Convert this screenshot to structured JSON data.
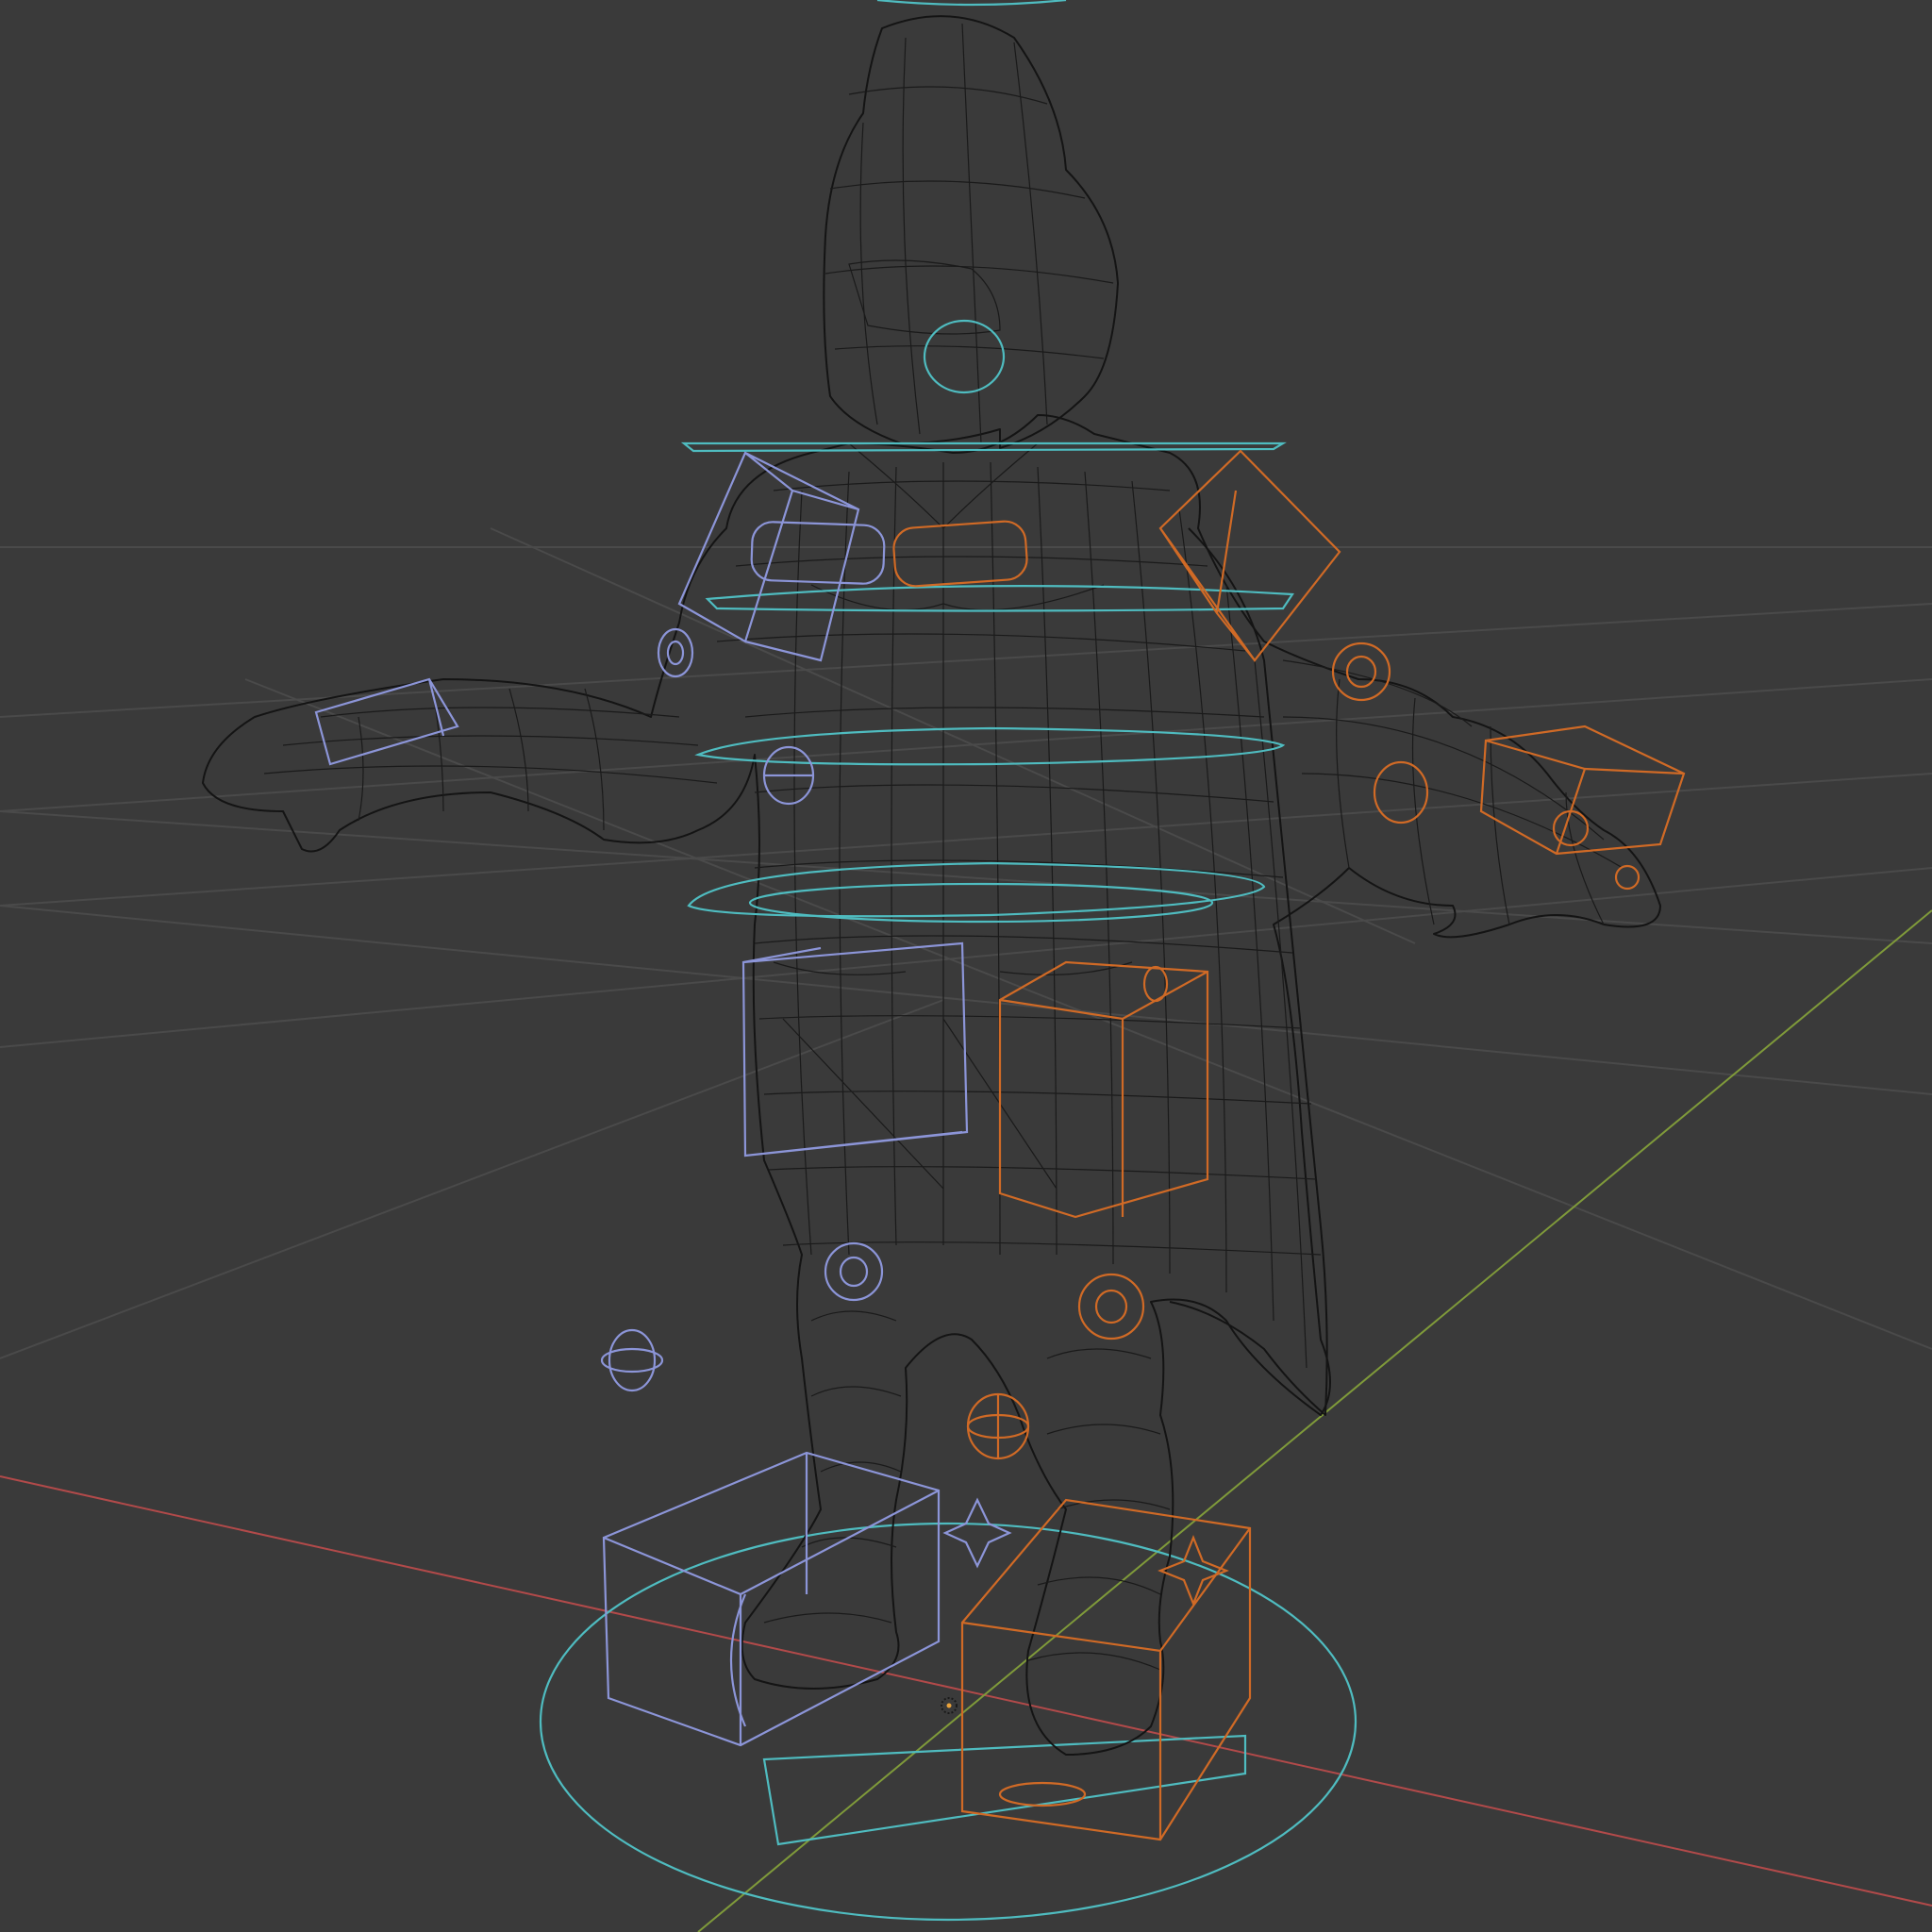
{
  "viewport": {
    "background_color": "#3a3a3a",
    "grid_color": "#4a4a4a",
    "axis_x_color": "#b24a4a",
    "axis_y_color": "#7f9a3a"
  },
  "mesh": {
    "object": "armored-character",
    "display": "wireframe",
    "wire_color": "#141414"
  },
  "rig_controls": {
    "center_color": "#4fbcc0",
    "left_color": "#8c95d8",
    "right_color": "#d06a26"
  },
  "origin_marker": {
    "icon": "object-origin-icon"
  }
}
